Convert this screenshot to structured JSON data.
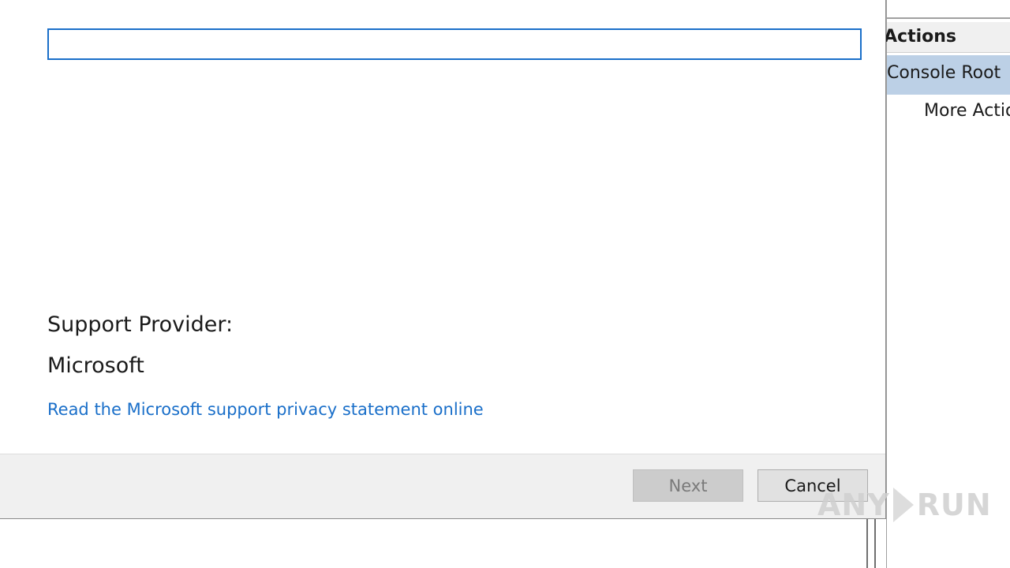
{
  "dialog": {
    "name_input_value": "",
    "support_provider_label": "Support Provider:",
    "support_provider_value": "Microsoft",
    "privacy_link": "Read the Microsoft support privacy statement online",
    "next_label": "Next",
    "cancel_label": "Cancel"
  },
  "actions_pane": {
    "header": "Actions",
    "group": "Console Root",
    "items": [
      "More Actions"
    ]
  },
  "watermark": {
    "left": "ANY",
    "right": "RUN"
  },
  "colors": {
    "link": "#1a6fc9",
    "input_focus_border": "#1a6fc9",
    "selected_group_bg": "#bcd0e6",
    "footer_bg": "#f0f0f0",
    "disabled_button_bg": "#cccccc"
  },
  "icons": [
    "play-triangle-icon"
  ]
}
